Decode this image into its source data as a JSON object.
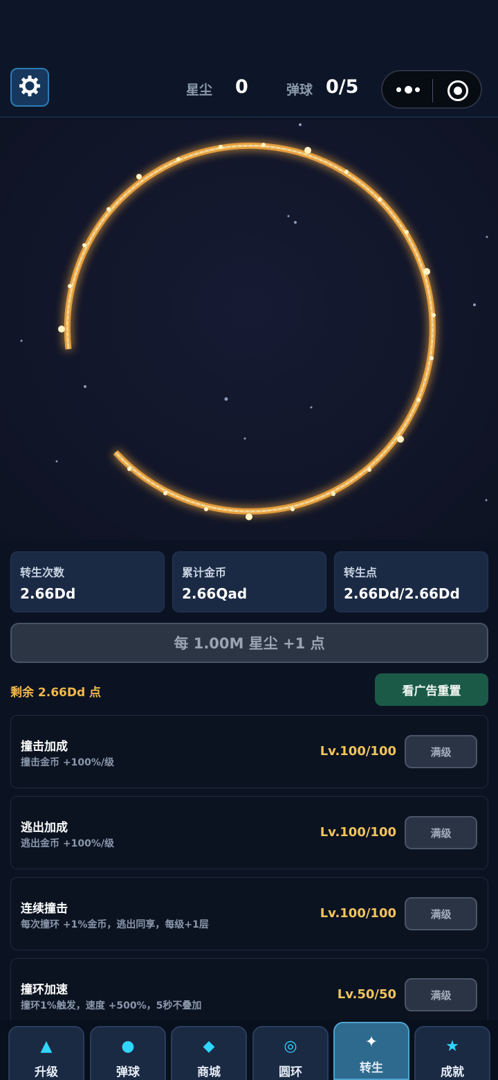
{
  "hud": {
    "stardust_label": "星尘",
    "stardust_value": "0",
    "balls_label": "弹球",
    "balls_value": "0/5"
  },
  "stats": [
    {
      "label": "转生次数",
      "value": "2.66Dd"
    },
    {
      "label": "累计金币",
      "value": "2.66Qad"
    },
    {
      "label": "转生点",
      "value": "2.66Dd/2.66Dd"
    }
  ],
  "rate_text": "每 1.00M 星尘 +1 点",
  "remaining_text": "剩余 2.66Dd 点",
  "ad_reset_label": "看广告重置",
  "upgrades": [
    {
      "name": "撞击加成",
      "desc": "撞击金币 +100%/级",
      "level": "Lv.100/100",
      "button": "满级"
    },
    {
      "name": "逃出加成",
      "desc": "逃出金币 +100%/级",
      "level": "Lv.100/100",
      "button": "满级"
    },
    {
      "name": "连续撞击",
      "desc": "每次撞环 +1%金币，逃出同享，每级+1层",
      "level": "Lv.100/100",
      "button": "满级"
    },
    {
      "name": "撞环加速",
      "desc": "撞环1%触发，速度 +500%，5秒不叠加",
      "level": "Lv.50/50",
      "button": "满级"
    }
  ],
  "nav": [
    {
      "label": "升级",
      "icon": "triangle-icon",
      "glyph": "▲"
    },
    {
      "label": "弹球",
      "icon": "ball-icon",
      "glyph": "●"
    },
    {
      "label": "商城",
      "icon": "diamond-icon",
      "glyph": "◆"
    },
    {
      "label": "圆环",
      "icon": "ring-icon",
      "glyph": "◎"
    },
    {
      "label": "转生",
      "icon": "sparkle-icon",
      "glyph": "✦"
    },
    {
      "label": "成就",
      "icon": "star-icon",
      "glyph": "★"
    }
  ],
  "active_tab": "转生",
  "colors": {
    "accent_cyan": "#2fd6ff",
    "ring_gold": "#f0a640",
    "level_gold": "#f2c45c",
    "ad_button": "#1c5a48"
  }
}
